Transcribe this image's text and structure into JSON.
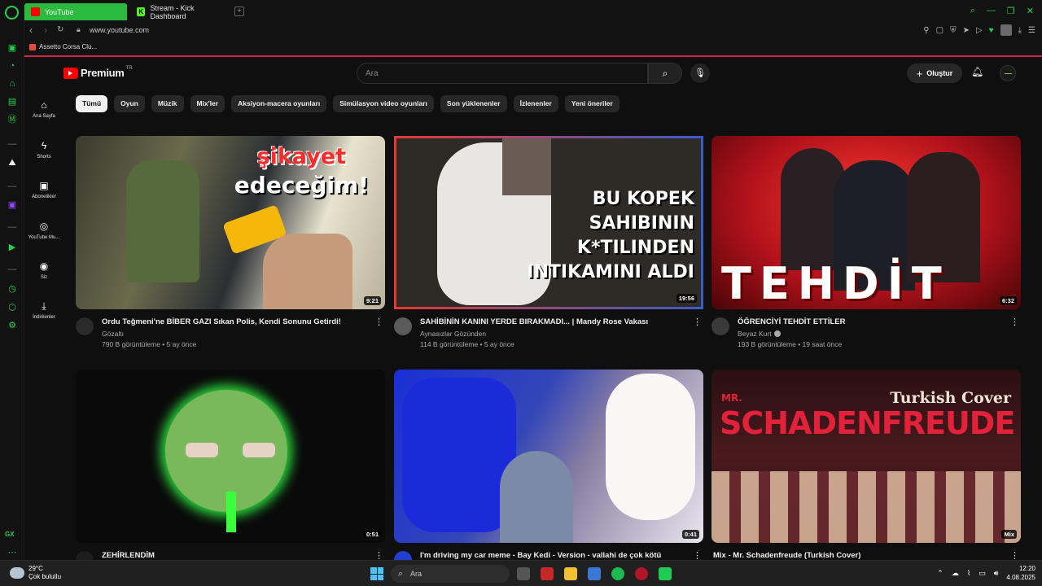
{
  "browser": {
    "tabs": [
      {
        "label": "YouTube",
        "active": true
      },
      {
        "label": "Stream - Kick Dashboard",
        "active": false
      }
    ],
    "url": "www.youtube.com",
    "bookmark": "Assetto Corsa Clu...",
    "gx_label": "GX",
    "accent_color": "#21d14b"
  },
  "yt": {
    "logo_text": "Premium",
    "region": "TR",
    "search_placeholder": "Ara",
    "create_label": "Oluştur",
    "rail": [
      {
        "label": "Ana Sayfa",
        "icon": "home-icon"
      },
      {
        "label": "Shorts",
        "icon": "shorts-icon"
      },
      {
        "label": "Abonelikler",
        "icon": "subscriptions-icon"
      },
      {
        "label": "YouTube Mu...",
        "icon": "youtube-music-icon"
      },
      {
        "label": "Siz",
        "icon": "you-icon"
      },
      {
        "label": "İndirilenler",
        "icon": "downloads-icon"
      }
    ],
    "chips": [
      "Tümü",
      "Oyun",
      "Müzik",
      "Mix'ler",
      "Aksiyon-macera oyunları",
      "Simülasyon video oyunları",
      "Son yüklenenler",
      "İzlenenler",
      "Yeni öneriler"
    ],
    "videos": [
      {
        "title": "Ordu Teğmeni'ne BİBER GAZI Sıkan Polis, Kendi Sonunu Getirdi!",
        "channel": "Gözaltı",
        "stats": "790 B görüntüleme • 5 ay önce",
        "duration": "9:21",
        "overlay": [
          "şikayet",
          "edeceğim!"
        ]
      },
      {
        "title": "SAHİBİNİN KANINI YERDE BIRAKMADI... | Mandy Rose Vakası",
        "channel": "Aynasızlar Gözünden",
        "stats": "114 B görüntüleme • 5 ay önce",
        "duration": "19:56",
        "overlay": [
          "BU KOPEK",
          "SAHIBININ",
          "K*TILINDEN",
          "INTIKAMINI ALDI"
        ]
      },
      {
        "title": "ÖĞRENCİYİ TEHDİT ETTİLER",
        "channel": "Beyaz Kurt",
        "stats": "193 B görüntüleme • 19 saat önce",
        "duration": "6:32",
        "overlay": [
          "TEHDİT"
        ]
      },
      {
        "title": "ZEHİRLENDİM",
        "channel": "",
        "stats": "",
        "duration": "0:51",
        "overlay": []
      },
      {
        "title": "I'm driving my car meme - Bay Kedi - Version - vallahi de çok kötü",
        "channel": "",
        "stats": "",
        "duration": "0:41",
        "overlay": []
      },
      {
        "title": "Mix - Mr. Schadenfreude (Turkish Cover)",
        "channel": "",
        "stats": "",
        "duration": "Mix",
        "overlay": [
          "Turkish Cover",
          "MR.",
          "SCHADENFREUDE"
        ]
      }
    ]
  },
  "taskbar": {
    "weather_temp": "29°C",
    "weather_desc": "Çok bulutlu",
    "search_placeholder": "Ara",
    "time": "12:20",
    "date": "4.08.2025"
  }
}
